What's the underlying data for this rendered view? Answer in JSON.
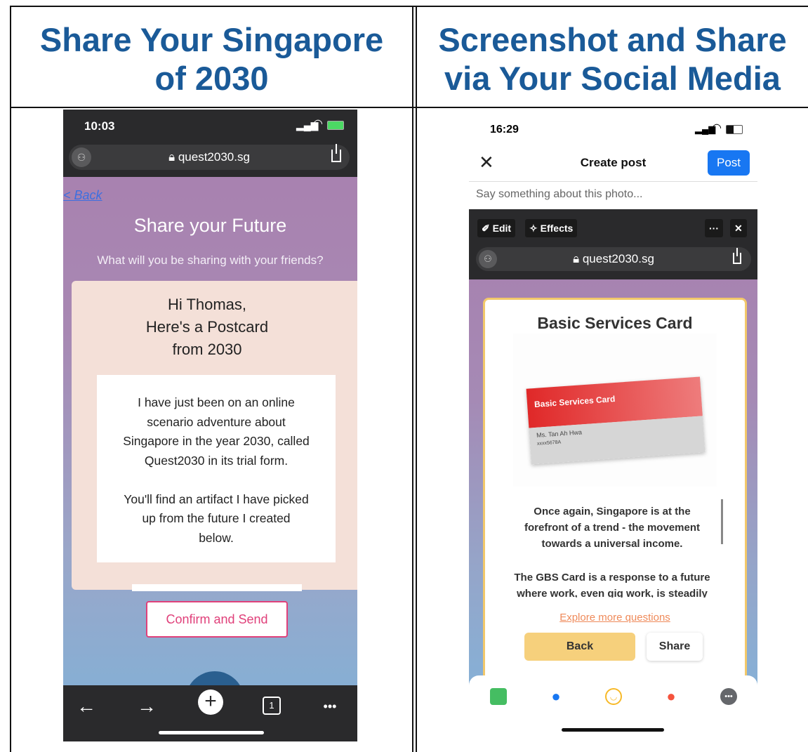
{
  "headers": {
    "left": "Share Your Singapore\nof 2030",
    "right": "Screenshot and Share\nvia Your Social Media"
  },
  "left_phone": {
    "status_time": "10:03",
    "url": "quest2030.sg",
    "back_link": "< Back",
    "title": "Share your Future",
    "subtitle": "What will you be sharing with your friends?",
    "greeting": "Hi Thomas,\nHere's a Postcard\nfrom 2030",
    "message": "I have just been on an online\nscenario adventure about\nSingapore in the year 2030, called\nQuest2030 in its trial form.\n\nYou'll find an artifact I have picked\nup from the future I created\nbelow.",
    "confirm_button": "Confirm and Send",
    "tab_count": "1",
    "more": "•••"
  },
  "right_phone": {
    "status_time": "16:29",
    "close": "✕",
    "create_post": "Create post",
    "post_button": "Post",
    "placeholder": "Say something about this photo...",
    "edit_button": "Edit",
    "effects_button": "Effects",
    "overlay_more": "···",
    "overlay_close": "✕",
    "url": "quest2030.sg",
    "card_title": "Basic Services Card",
    "card_header": "Basic Services Card",
    "card_name": "Ms. Tan Ah Hwa",
    "card_id": "xxxx5678A",
    "desc1": "Once again, Singapore is at the\nforefront of a trend - the movement\ntowards a universal income.",
    "desc2": "The GBS Card is a response to a future\nwhere work, even gig work, is steadily",
    "explore": "Explore more questions",
    "back": "Back",
    "share": "Share"
  },
  "colors": {
    "header_blue": "#1a5a98",
    "confirm_pink": "#e0407a",
    "fb_blue": "#1877f2",
    "card_red": "#e02828",
    "back_yellow": "#f6d07c"
  }
}
